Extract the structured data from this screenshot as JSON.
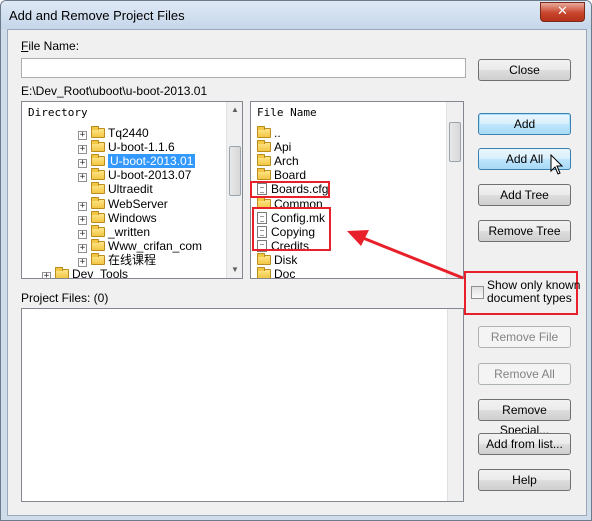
{
  "window": {
    "title": "Add and Remove Project Files",
    "close_glyph": "✕"
  },
  "file_name": {
    "label": "File Name:",
    "value": ""
  },
  "path": "E:\\Dev_Root\\uboot\\u-boot-2013.01",
  "directory": {
    "header": "Directory",
    "items": [
      {
        "label": "Tq2440",
        "expander": "+"
      },
      {
        "label": "U-boot-1.1.6",
        "expander": "+"
      },
      {
        "label": "U-boot-2013.01",
        "expander": "+",
        "selected": true
      },
      {
        "label": "U-boot-2013.07",
        "expander": "+"
      },
      {
        "label": "Ultraedit",
        "expander": ""
      },
      {
        "label": "WebServer",
        "expander": "+"
      },
      {
        "label": "Windows",
        "expander": "+"
      },
      {
        "label": "_written",
        "expander": "+"
      },
      {
        "label": "Www_crifan_com",
        "expander": "+"
      },
      {
        "label": "在线课程",
        "expander": "+"
      },
      {
        "label": "Dev_Tools",
        "expander": "+"
      }
    ]
  },
  "files": {
    "header": "File Name",
    "items": [
      {
        "label": "..",
        "kind": "up"
      },
      {
        "label": "Api",
        "kind": "folder"
      },
      {
        "label": "Arch",
        "kind": "folder"
      },
      {
        "label": "Board",
        "kind": "folder"
      },
      {
        "label": "Boards.cfg",
        "kind": "file"
      },
      {
        "label": "Common",
        "kind": "folder"
      },
      {
        "label": "Config.mk",
        "kind": "file"
      },
      {
        "label": "Copying",
        "kind": "file"
      },
      {
        "label": "Credits",
        "kind": "file"
      },
      {
        "label": "Disk",
        "kind": "folder"
      },
      {
        "label": "Doc",
        "kind": "folder"
      }
    ]
  },
  "buttons": {
    "close": "Close",
    "add": "Add",
    "add_all": "Add All",
    "add_tree": "Add Tree",
    "remove_tree": "Remove Tree",
    "remove_file": "Remove File",
    "remove_all": "Remove All",
    "remove_special": "Remove Special...",
    "add_from_list": "Add from list...",
    "help": "Help"
  },
  "show_only_known": {
    "line1": "Show only known",
    "line2": "document types",
    "checked": false
  },
  "project_files": {
    "label": "Project Files: (0)"
  },
  "colors": {
    "annotation_red": "#e8202a",
    "selection_blue": "#3399ff"
  },
  "icons": {
    "arrow": "red-arrow-icon",
    "cursor": "mouse-pointer-icon"
  }
}
